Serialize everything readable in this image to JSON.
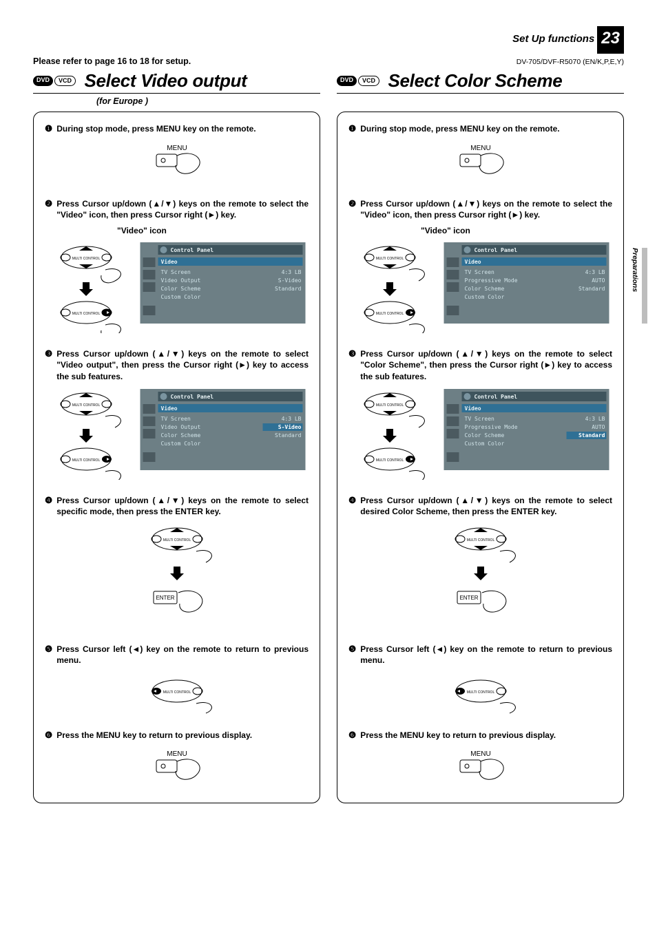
{
  "header": {
    "section": "Set Up functions",
    "page_number": "23",
    "model_line": "DV-705/DVF-R5070 (EN/K,P,E,Y)",
    "refer": "Please refer to page 16 to 18 for setup."
  },
  "sidetab": "Preparations",
  "disks": {
    "dvd": "DVD",
    "vcd": "VCD"
  },
  "left": {
    "title": "Select Video output",
    "subtitle": "(for Europe )",
    "steps": {
      "1": "During stop mode, press MENU key on the remote.",
      "2": "Press Cursor up/down (▲/▼) keys on the remote to select the \"Video\" icon, then press Cursor right (►) key.",
      "video_icon_label": "\"Video\" icon",
      "3": "Press Cursor up/down (▲/▼) keys on the remote to select \"Video output\", then press the Cursor right (►) key to access the sub features.",
      "4": "Press Cursor up/down (▲/▼) keys on the remote to select specific mode, then press the ENTER key.",
      "5": "Press Cursor left (◄) key on the remote to return to previous menu.",
      "6": "Press the MENU key to return to previous display."
    },
    "remote": {
      "menu_label": "MENU",
      "enter_label": "ENTER",
      "multi_label": "MULTI CONTROL"
    },
    "osd1": {
      "title": "Control Panel",
      "cat": "Video",
      "rows": [
        {
          "l": "TV Screen",
          "r": "4:3 LB"
        },
        {
          "l": "Video Output",
          "r": "S-Video"
        },
        {
          "l": "Color Scheme",
          "r": "Standard"
        },
        {
          "l": "Custom Color",
          "r": ""
        }
      ],
      "highlight_index": -1
    },
    "osd2": {
      "title": "Control Panel",
      "cat": "Video",
      "rows": [
        {
          "l": "TV Screen",
          "r": "4:3 LB"
        },
        {
          "l": "Video Output",
          "r": "S-Video"
        },
        {
          "l": "Color Scheme",
          "r": "Standard"
        },
        {
          "l": "Custom Color",
          "r": ""
        }
      ],
      "highlight_index": 1
    }
  },
  "right": {
    "title": "Select Color Scheme",
    "steps": {
      "1": "During stop mode, press MENU key on the remote.",
      "2": "Press Cursor up/down (▲/▼) keys on the remote to select the \"Video\" icon, then press Cursor right (►) key.",
      "video_icon_label": "\"Video\" icon",
      "3": "Press Cursor up/down (▲/▼) keys on the remote to select \"Color Scheme\", then press the Cursor right (►) key to access the sub features.",
      "4": "Press Cursor up/down (▲/▼) keys on the remote to select desired Color Scheme, then press the ENTER key.",
      "5": "Press Cursor left (◄) key on the remote to return to previous menu.",
      "6": "Press the MENU key to return to previous display."
    },
    "remote": {
      "menu_label": "MENU",
      "enter_label": "ENTER",
      "multi_label": "MULTI CONTROL"
    },
    "osd1": {
      "title": "Control Panel",
      "cat": "Video",
      "rows": [
        {
          "l": "TV Screen",
          "r": "4:3 LB"
        },
        {
          "l": "Progressive Mode",
          "r": "AUTO"
        },
        {
          "l": "Color Scheme",
          "r": "Standard"
        },
        {
          "l": "Custom Color",
          "r": ""
        }
      ],
      "highlight_index": -1
    },
    "osd2": {
      "title": "Control Panel",
      "cat": "Video",
      "rows": [
        {
          "l": "TV Screen",
          "r": "4:3 LB"
        },
        {
          "l": "Progressive Mode",
          "r": "AUTO"
        },
        {
          "l": "Color Scheme",
          "r": "Standard"
        },
        {
          "l": "Custom Color",
          "r": ""
        }
      ],
      "highlight_index": 2
    }
  }
}
